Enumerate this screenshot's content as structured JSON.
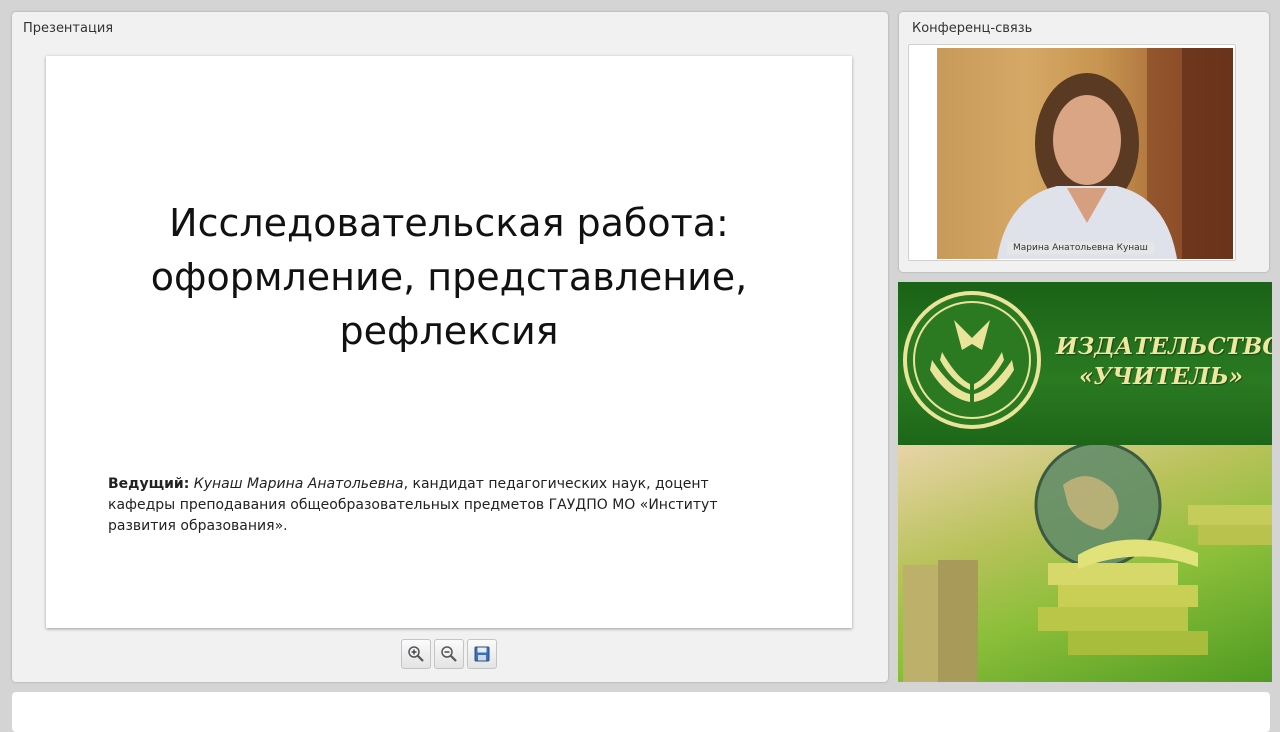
{
  "presentation": {
    "panel_title": "Презентация",
    "slide": {
      "title_lines": [
        "Исследовательская работа:",
        "оформление, представление,",
        "рефлексия"
      ],
      "presenter_label": "Ведущий:",
      "presenter_name": "Кунаш Марина Анатольевна",
      "presenter_rest": ", кандидат педагогических наук, доцент кафедры преподавания общеобразовательных предметов ГАУДПО МО «Институт развития образования»."
    },
    "toolbar": {
      "zoom_in_icon": "zoom-in-icon",
      "zoom_out_icon": "zoom-out-icon",
      "save_icon": "save-icon"
    }
  },
  "conference": {
    "panel_title": "Конференц-связь",
    "participant_name": "Марина Анатольевна Кунаш"
  },
  "ad": {
    "publisher_line1": "ИЗДАТЕЛЬСТВО",
    "publisher_line2": "«УЧИТЕЛЬ»"
  },
  "colors": {
    "ad_green": "#1f6a1a",
    "ad_text": "#efe6a0"
  }
}
